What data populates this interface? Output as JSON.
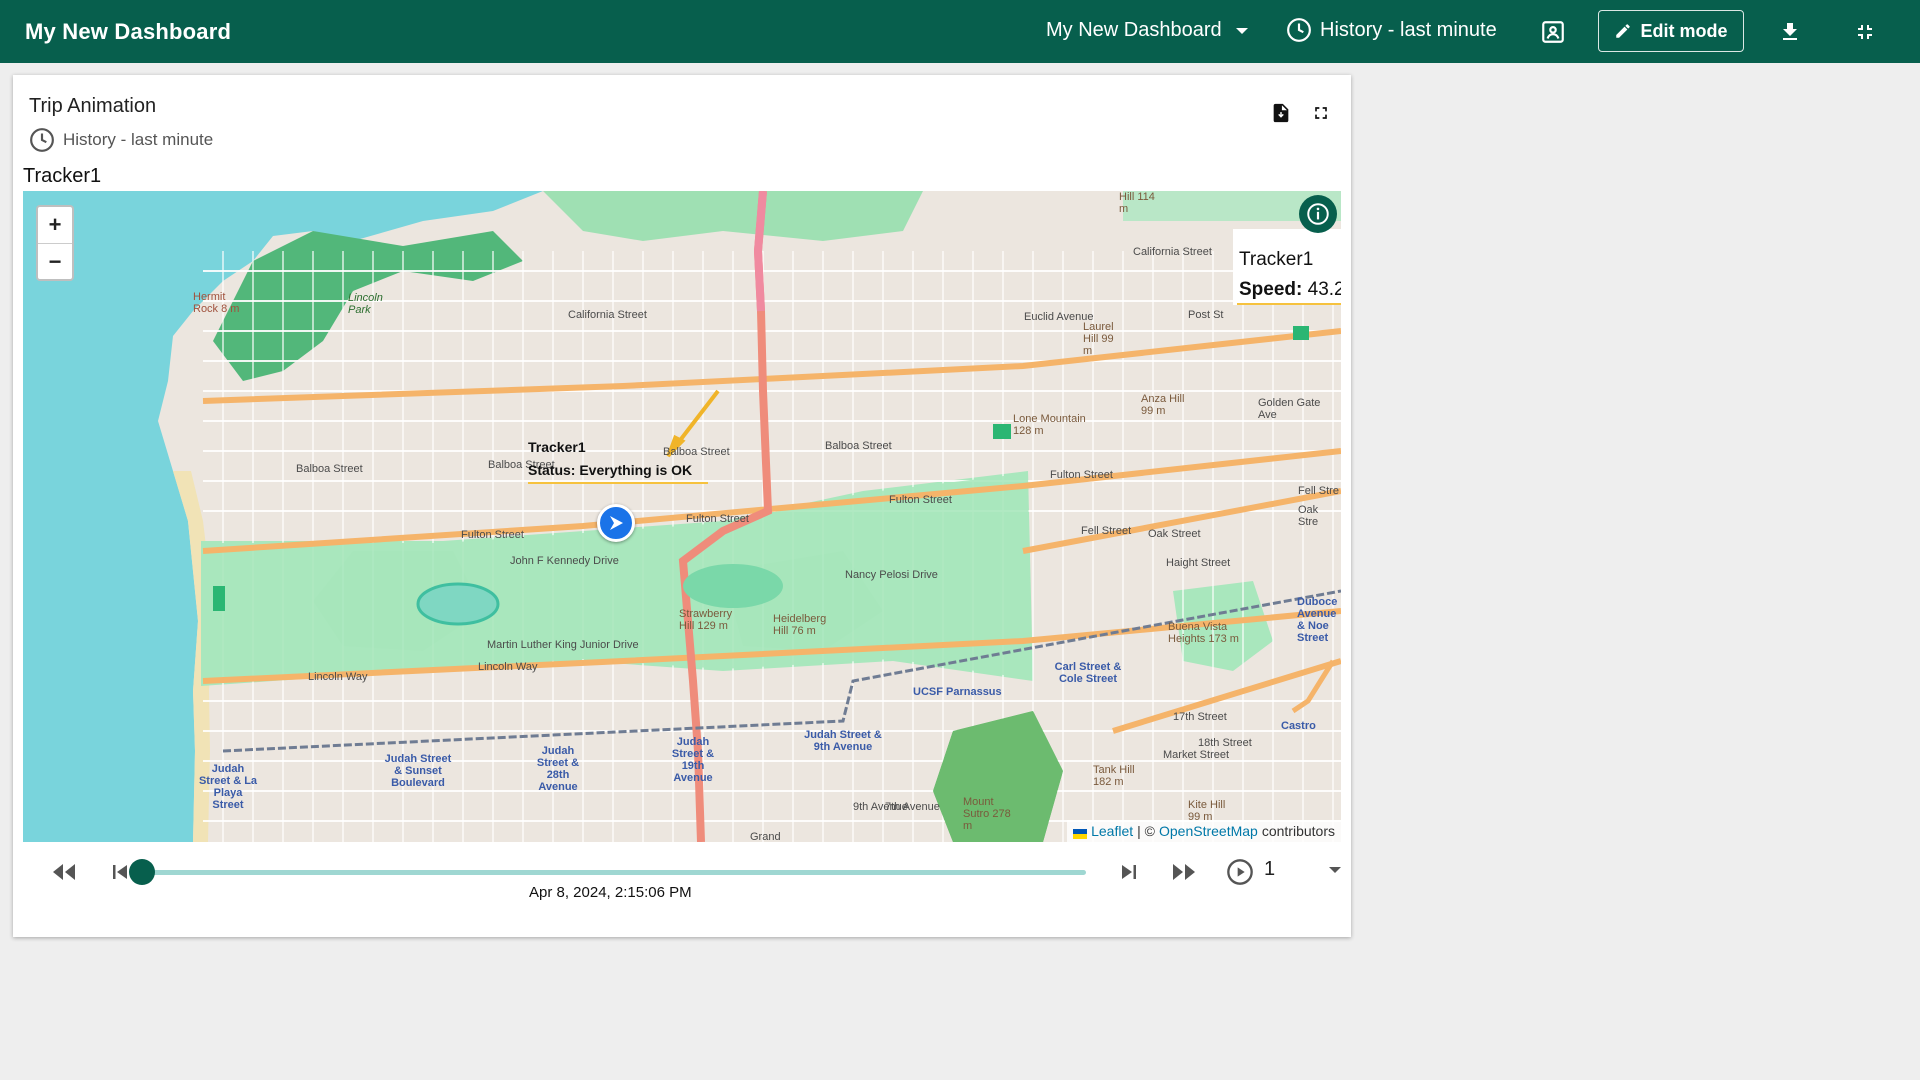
{
  "header": {
    "title": "My New Dashboard",
    "dashboard_select": "My New Dashboard",
    "history_label": "History - last minute",
    "edit_label": "Edit mode"
  },
  "widget": {
    "title": "Trip Animation",
    "timewindow": "History - last minute",
    "entity_label": "Tracker1"
  },
  "map": {
    "zoom_in": "+",
    "zoom_out": "−",
    "popup": {
      "name": "Tracker1",
      "speed_key": "Speed:",
      "speed_value": "43.2"
    },
    "marker_label": {
      "name": "Tracker1",
      "status": "Status: Everything is OK"
    },
    "attribution": {
      "leaflet": "Leaflet",
      "separator": "| ©",
      "osm": "OpenStreetMap",
      "suffix": "contributors"
    },
    "street_labels": [
      "California Street",
      "Balboa Street",
      "Balboa Street",
      "Balboa Street",
      "Balboa Street",
      "Fulton Street",
      "Fulton Street",
      "Fulton Street",
      "Fulton Street",
      "Fell Street",
      "Oak Street",
      "Haight Street",
      "Lincoln Way",
      "Lincoln Way",
      "John F Kennedy Drive",
      "Martin Luther King Junior Drive",
      "Nancy Pelosi Drive",
      "Euclid Avenue",
      "Golden Gate Ave",
      "Post St",
      "17th Street",
      "Market Street",
      "18th Street",
      "California Street",
      "Fell Stre",
      "Oak Stre"
    ],
    "place_labels": [
      "Hermit Rock 8 m",
      "Lincoln Park",
      "Lone Mountain 128 m",
      "Laurel Hill 99 m",
      "Anza Hill 99 m",
      "Strawberry Hill 129 m",
      "Heidelberg Hill 76 m",
      "Buena Vista Heights 173 m",
      "Tank Hill 182 m",
      "Kite Hill 99 m",
      "Mount Sutro 278 m",
      "Hill 114 m",
      "UCSF Parnassus",
      "Castro",
      "Carl Street & Cole Street",
      "Duboce Avenue & Noe Street",
      "Judah Street & La Playa Street",
      "Judah Street & Sunset Boulevard",
      "Judah Street & 28th Avenue",
      "Judah Street & 19th Avenue",
      "Judah Street & 9th Avenue",
      "9th Avenue",
      "7th Avenue",
      "Grand"
    ]
  },
  "player": {
    "timestamp": "Apr 8, 2024, 2:15:06 PM",
    "progress": 0,
    "speed": "1"
  },
  "colors": {
    "primary": "#075f4d",
    "slider_track": "#9fd7d2",
    "marker": "#1a73e8",
    "highlight": "#f6c23e"
  }
}
